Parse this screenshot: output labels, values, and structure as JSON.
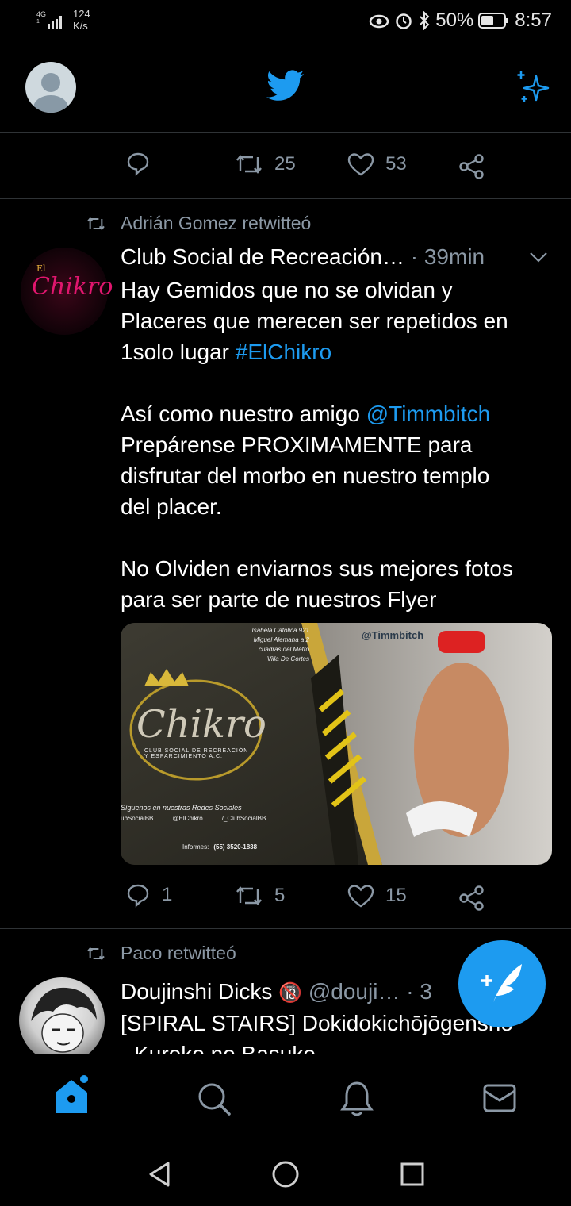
{
  "status_bar": {
    "network": "4G",
    "network_sub": "1l",
    "speed_value": "124",
    "speed_unit": "K/s",
    "battery": "50%",
    "time": "8:57"
  },
  "prev_tweet": {
    "retweets": "25",
    "likes": "53"
  },
  "tweet1": {
    "retweeted_by": "Adrián Gomez retwitteó",
    "name": "Club Social de Recreación…",
    "sep": "·",
    "time": "39min",
    "body_line1": "Hay Gemidos que no se olvidan y",
    "body_line2": "Placeres que merecen ser repetidos en",
    "body_line3_pre": "1solo lugar ",
    "hashtag": "#ElChikro",
    "body_para2_pre": "Así como nuestro amigo ",
    "mention": "@Timmbitch",
    "body_para2_l2": "Prepárense PROXIMAMENTE para",
    "body_para2_l3": "disfrutar del morbo en nuestro templo",
    "body_para2_l4": "del placer.",
    "body_para3_l1": "No Olviden enviarnos sus mejores fotos",
    "body_para3_l2": "para ser parte de nuestros Flyer",
    "replies": "1",
    "retweets": "5",
    "likes": "15",
    "avatar_text": "Chikro",
    "avatar_small": "El",
    "flyer": {
      "address_l1": "Isabela Catolica 921",
      "address_l2": "Miguel Alemana a 2",
      "address_l3": "cuadras del Metro",
      "address_l4": "Villa De Cortes",
      "handle": "@Timmbitch",
      "logo": "Chikro",
      "club_l1": "CLUB SOCIAL DE RECREACIÓN",
      "club_l2": "Y ESPARCIMIENTO A.C.",
      "follow": "Síguenos en nuestras Redes Sociales",
      "social1": "ubSocialBB",
      "social2": "@ElChikro",
      "social3": "/_ClubSocialBB",
      "informes": "Informes:",
      "phone": "(55) 3520-1838"
    }
  },
  "tweet2": {
    "retweeted_by": "Paco retwitteó",
    "name": "Doujinshi Dicks",
    "badge": "🔞",
    "handle": "@douji…",
    "sep": "·",
    "time": "3",
    "body_line1": "[SPIRAL STAIRS] Dokidokichōjōgenshō",
    "body_line2": "- Kuroko no Basuke"
  },
  "colors": {
    "accent": "#1d9bf0",
    "muted": "#8b98a5",
    "divider": "#2f3336"
  },
  "icons": {
    "header_logo": "twitter-bird-icon",
    "header_right": "sparkle-icon",
    "nav": [
      "home-icon",
      "search-icon",
      "notifications-icon",
      "messages-icon"
    ],
    "system": [
      "back-icon",
      "home-circle-icon",
      "recents-icon"
    ]
  }
}
